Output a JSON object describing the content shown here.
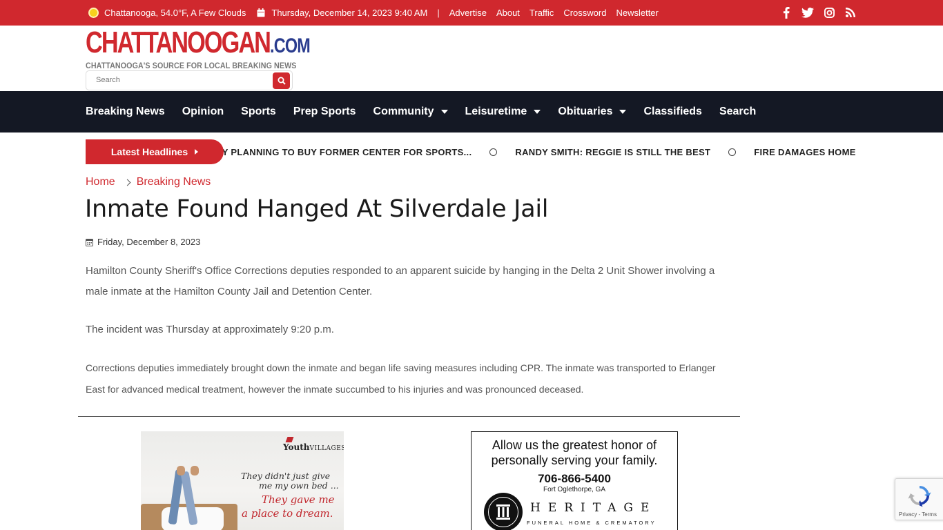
{
  "topbar": {
    "weather": "Chattanooga, 54.0°F, A Few Clouds",
    "datetime": "Thursday, December 14, 2023 9:40 AM",
    "separator": "|",
    "links": [
      "Advertise",
      "About",
      "Traffic",
      "Crossword",
      "Newsletter"
    ],
    "social_icons": [
      "facebook-icon",
      "twitter-icon",
      "instagram-icon",
      "rss-icon"
    ],
    "background_color": "#d0282e"
  },
  "header": {
    "logo_main": "CHATTANOOGAN",
    "logo_suffix": ".COM",
    "tagline": "CHATTANOOGA'S SOURCE FOR LOCAL BREAKING NEWS",
    "search_placeholder": "Search"
  },
  "nav": {
    "items": [
      {
        "label": "Breaking News",
        "dropdown": false
      },
      {
        "label": "Opinion",
        "dropdown": false
      },
      {
        "label": "Sports",
        "dropdown": false
      },
      {
        "label": "Prep Sports",
        "dropdown": false
      },
      {
        "label": "Community",
        "dropdown": true
      },
      {
        "label": "Leisuretime",
        "dropdown": true
      },
      {
        "label": "Obituaries",
        "dropdown": true
      },
      {
        "label": "Classifieds",
        "dropdown": false
      },
      {
        "label": "Search",
        "dropdown": false
      }
    ],
    "background_color": "#141824"
  },
  "ticker": {
    "label": "Latest Headlines",
    "items": [
      "COUNTY PLANNING TO BUY FORMER CENTER FOR SPORTS...",
      "RANDY SMITH: REGGIE IS STILL THE BEST",
      "FIRE DAMAGES HOME ON WALKER..."
    ]
  },
  "breadcrumb": {
    "home": "Home",
    "current": "Breaking News"
  },
  "article": {
    "title": "Inmate Found Hanged At Silverdale Jail",
    "date": "Friday, December 8, 2023",
    "paragraphs": [
      "Hamilton County Sheriff's Office Corrections deputies responded to an apparent suicide by hanging in the Delta 2 Unit Shower involving a male inmate at the Hamilton County Jail and Detention Center.",
      "The incident was Thursday at approximately 9:20 p.m.",
      "Corrections deputies immediately brought down the inmate and began life saving measures including CPR. The inmate was transported to Erlanger East for advanced medical treatment, however the inmate succumbed to his injuries and was pronounced deceased."
    ]
  },
  "ads": {
    "youth_villages": {
      "brand": "Youth",
      "brand_suffix": "VILLAGES.",
      "line1": "They didn't just give",
      "line2": "me my own bed ...",
      "line3": "They gave me",
      "line4": "a place to dream."
    },
    "heritage": {
      "headline": "Allow us the greatest honor of personally serving your family.",
      "phone": "706-866-5400",
      "location": "Fort Oglethorpe, GA",
      "name": "HERITAGE",
      "subtitle": "FUNERAL HOME & CREMATORY"
    }
  },
  "recaptcha": {
    "links": "Privacy - Terms"
  }
}
